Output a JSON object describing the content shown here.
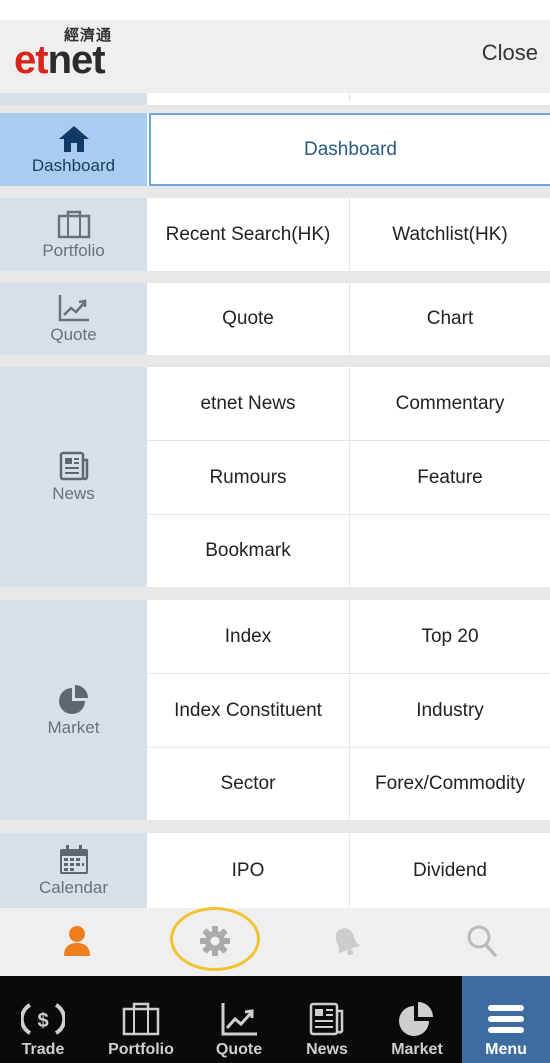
{
  "header": {
    "logo_cn": "經濟通",
    "logo_e": "e",
    "logo_t": "t",
    "logo_rest": "net",
    "close_label": "Close"
  },
  "sections": {
    "dashboard": {
      "label": "Dashboard",
      "items": [
        "Dashboard"
      ]
    },
    "portfolio": {
      "label": "Portfolio",
      "items": [
        "Recent Search(HK)",
        "Watchlist(HK)"
      ]
    },
    "quote": {
      "label": "Quote",
      "items": [
        "Quote",
        "Chart"
      ]
    },
    "news": {
      "label": "News",
      "items": [
        "etnet News",
        "Commentary",
        "Rumours",
        "Feature",
        "Bookmark"
      ]
    },
    "market": {
      "label": "Market",
      "items": [
        "Index",
        "Top 20",
        "Index Constituent",
        "Industry",
        "Sector",
        "Forex/Commodity"
      ]
    },
    "calendar": {
      "label": "Calendar",
      "items": [
        "IPO",
        "Dividend"
      ]
    }
  },
  "toolbar": {
    "icons": [
      "user-icon",
      "gear-icon",
      "bell-icon",
      "search-icon"
    ],
    "colors": {
      "user": "#f07d1e",
      "gear": "#aaaaaa",
      "bell": "#cccccc",
      "search": "#bbbbbb",
      "highlight": "#f2c230"
    }
  },
  "bottom_nav": {
    "items": [
      "Trade",
      "Portfolio",
      "Quote",
      "News",
      "Market",
      "Menu"
    ],
    "active": "Menu"
  },
  "colors": {
    "sidebar": "#d7e0e8",
    "active_side": "#a9cdf0",
    "nav_bg": "#0a0a0a",
    "nav_active": "#3d6da0",
    "brand_red": "#d9251c"
  }
}
